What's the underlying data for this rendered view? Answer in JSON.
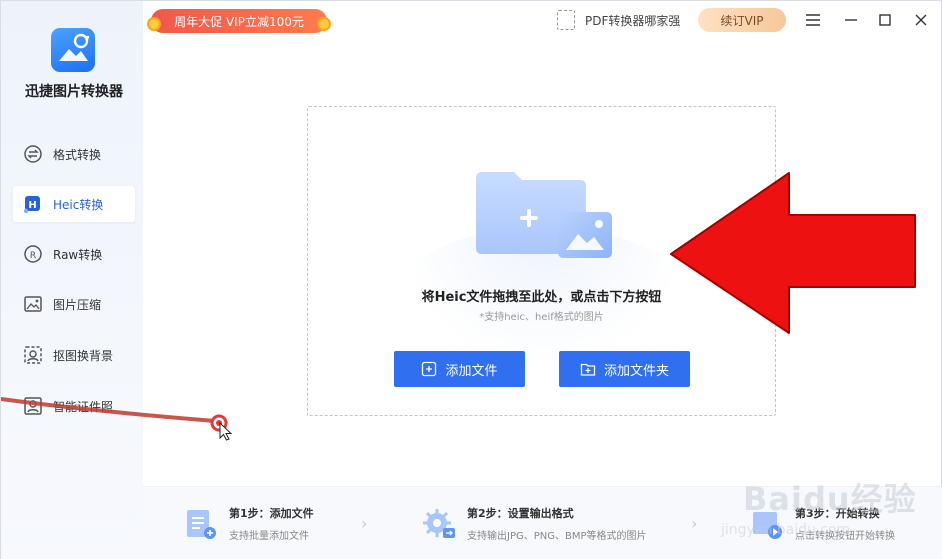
{
  "app": {
    "name": "迅捷图片转换器"
  },
  "sidebar": {
    "items": [
      {
        "label": "格式转换",
        "icon": "format-convert-icon",
        "active": false
      },
      {
        "label": "Heic转换",
        "icon": "heic-icon",
        "active": true
      },
      {
        "label": "Raw转换",
        "icon": "raw-icon",
        "active": false
      },
      {
        "label": "图片压缩",
        "icon": "image-compress-icon",
        "active": false
      },
      {
        "label": "抠图换背景",
        "icon": "cutout-icon",
        "active": false
      },
      {
        "label": "智能证件照",
        "icon": "id-photo-icon",
        "active": false
      }
    ]
  },
  "topbar": {
    "promo": "周年大促 VIP立减100元",
    "pdf_ad": "PDF转换器哪家强",
    "vip_button": "续订VIP",
    "menu_icon": "≡",
    "minimize_icon": "—",
    "maximize_icon": "□",
    "close_icon": "✕"
  },
  "dropzone": {
    "title": "将Heic文件拖拽至此处，或点击下方按钮",
    "subtitle": "*支持heic、heif格式的图片",
    "add_file": "添加文件",
    "add_folder": "添加文件夹"
  },
  "steps": [
    {
      "title": "第1步：添加文件",
      "desc": "支持批量添加文件"
    },
    {
      "title": "第2步：设置输出格式",
      "desc": "支持输出JPG、PNG、BMP等格式的图片"
    },
    {
      "title": "第3步：开始转换",
      "desc": "点击转换按钮开始转换"
    }
  ],
  "watermark": {
    "main": "Baidu经验",
    "sub": "jingyan.baidu.com"
  },
  "colors": {
    "primary": "#2f6ff0",
    "sidebar_bg": "#eef3fb",
    "promo": "#f2574a",
    "vip": "#f7c79b",
    "annotation_red": "#ee1111"
  }
}
